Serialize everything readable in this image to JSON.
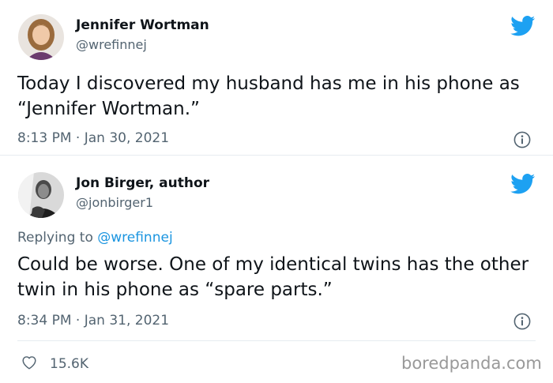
{
  "tweet1": {
    "author_name": "Jennifer Wortman",
    "handle": "@wrefinnej",
    "text": "Today I discovered my husband has me in his phone as “Jennifer Wortman.”",
    "time": "8:13 PM",
    "separator": "·",
    "date": "Jan 30, 2021"
  },
  "tweet2": {
    "author_name": "Jon Birger, author",
    "handle": "@jonbirger1",
    "reply_prefix": "Replying to ",
    "reply_mention": "@wrefinnej",
    "text": "Could be worse. One of my identical twins has the other twin in his phone as “spare parts.”",
    "time": "8:34 PM",
    "separator": "·",
    "date": "Jan 31, 2021"
  },
  "actions": {
    "like_icon": "heart-outline-icon",
    "like_count": "15.6K"
  },
  "watermark": "boredpanda.com",
  "icons": {
    "brand": "twitter-bird-icon",
    "info": "info-icon"
  },
  "colors": {
    "twitter_blue": "#1da1f2",
    "mention_blue": "#1b95e0",
    "text": "#0f1419",
    "secondary": "#536471",
    "watermark": "#999999"
  }
}
